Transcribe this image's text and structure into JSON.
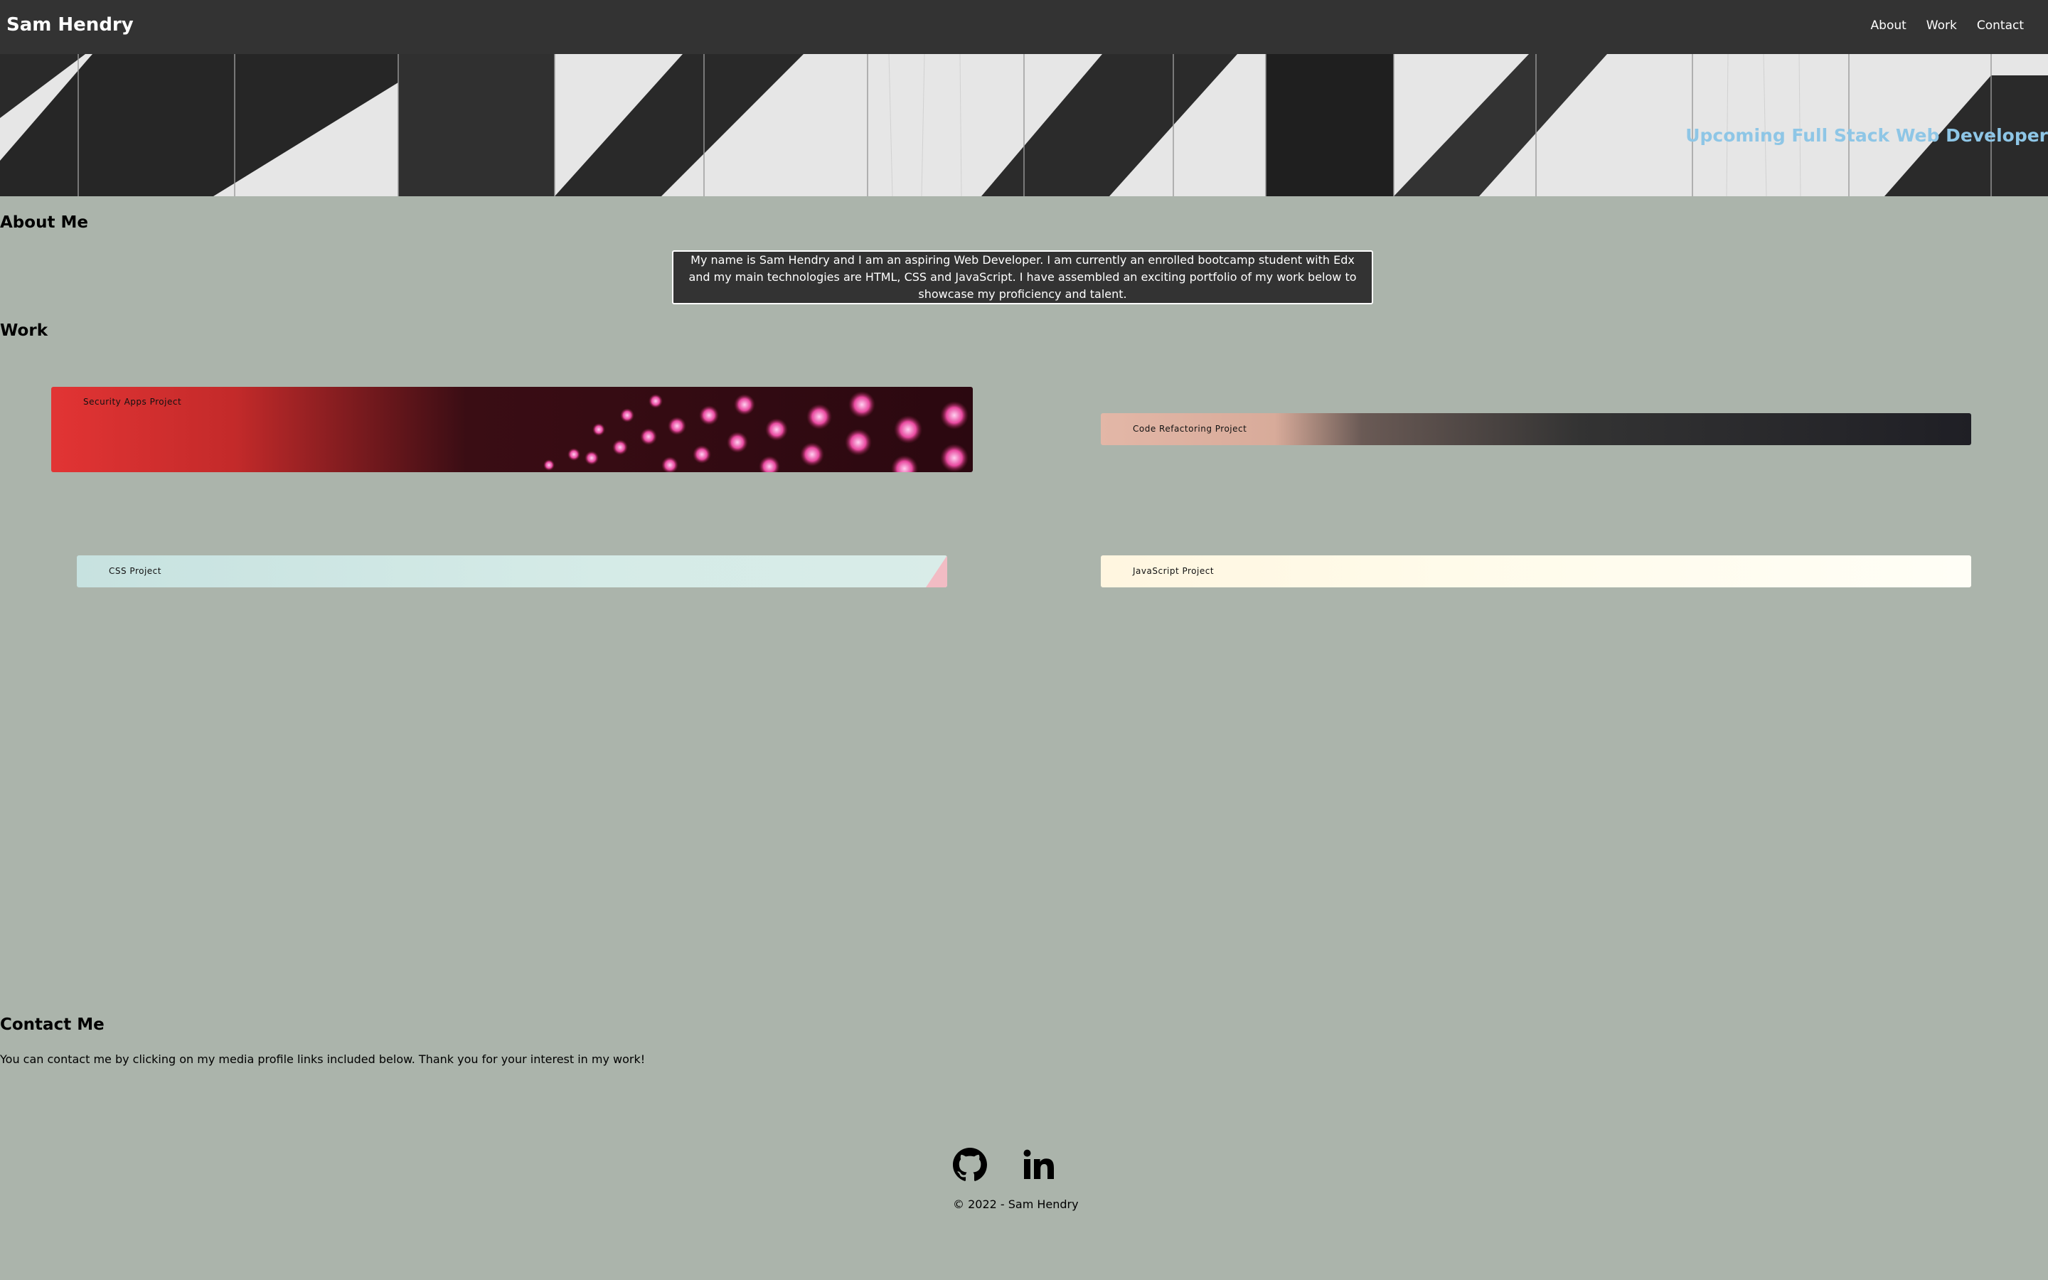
{
  "header": {
    "brand": "Sam Hendry",
    "nav": [
      {
        "label": "About"
      },
      {
        "label": "Work"
      },
      {
        "label": "Contact"
      }
    ]
  },
  "hero": {
    "tagline": "Upcoming Full Stack Web Developer"
  },
  "about": {
    "title": "About Me",
    "text": "My name is Sam Hendry and I am an aspiring Web Developer. I am currently an enrolled bootcamp student with Edx and my main technologies are HTML, CSS and JavaScript. I have assembled an exciting portfolio of my work below to showcase my proficiency and talent."
  },
  "work": {
    "title": "Work",
    "projects": [
      {
        "label": "Security Apps Project"
      },
      {
        "label": "Code Refactoring Project"
      },
      {
        "label": "CSS Project"
      },
      {
        "label": "JavaScript Project"
      }
    ]
  },
  "contact": {
    "title": "Contact Me",
    "text": "You can contact me by clicking on my media profile links included below. Thank you for your interest in my work!",
    "socials": [
      {
        "icon": "github-icon"
      },
      {
        "icon": "linkedin-icon"
      }
    ]
  },
  "footer": {
    "copyright": "© 2022 - Sam Hendry"
  },
  "colors": {
    "topbar": "#333333",
    "background": "#abb4ab",
    "tagline": "#8ec6e6"
  }
}
